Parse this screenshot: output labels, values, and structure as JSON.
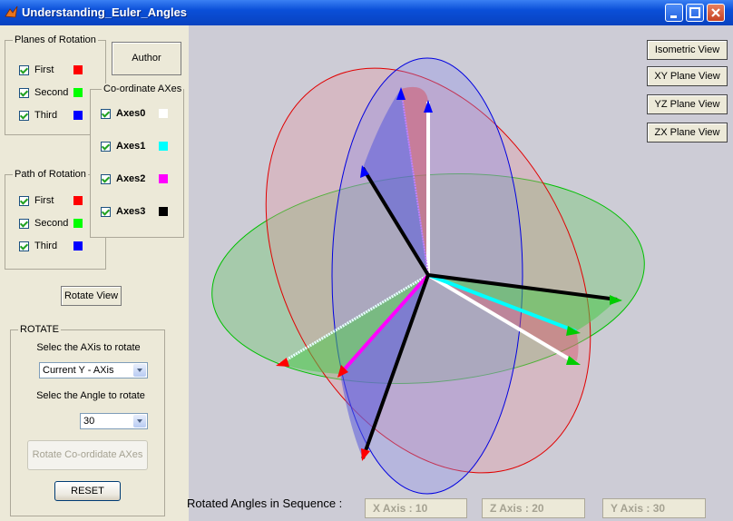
{
  "window": {
    "title": "Understanding_Euler_Angles"
  },
  "planes_of_rotation": {
    "label": "Planes of Rotation",
    "items": [
      {
        "label": "First",
        "color": "#ff0000",
        "checked": true
      },
      {
        "label": "Second",
        "color": "#00ff00",
        "checked": true
      },
      {
        "label": "Third",
        "color": "#0000ff",
        "checked": true
      }
    ]
  },
  "author_button": "Author",
  "coordinate_axes": {
    "label": "Co-ordinate AXes",
    "items": [
      {
        "label": "Axes0",
        "color": "#ffffff",
        "checked": true
      },
      {
        "label": "Axes1",
        "color": "#00ffff",
        "checked": true
      },
      {
        "label": "Axes2",
        "color": "#ff00ff",
        "checked": true
      },
      {
        "label": "Axes3",
        "color": "#000000",
        "checked": true
      }
    ]
  },
  "path_of_rotation": {
    "label": "Path of Rotation",
    "items": [
      {
        "label": "First",
        "color": "#ff0000",
        "checked": true
      },
      {
        "label": "Second",
        "color": "#00ff00",
        "checked": true
      },
      {
        "label": "Third",
        "color": "#0000ff",
        "checked": true
      }
    ]
  },
  "rotate_view_button": "Rotate View",
  "rotate": {
    "label": "ROTATE",
    "axis_prompt": "Selec the AXis to rotate",
    "axis_value": "Current Y - AXis",
    "angle_prompt": "Selec the Angle to rotate",
    "angle_value": "30",
    "rotate_button": "Rotate Co-ordidate AXes",
    "reset_button": "RESET"
  },
  "view_buttons": [
    "Isometric View",
    "XY Plane View",
    "YZ Plane View",
    "ZX Plane View"
  ],
  "sequence": {
    "label": "Rotated Angles in Sequence :",
    "x": "X Axis  :  10",
    "z": "Z Axis  :  20",
    "y": "Y Axis  :  30"
  }
}
